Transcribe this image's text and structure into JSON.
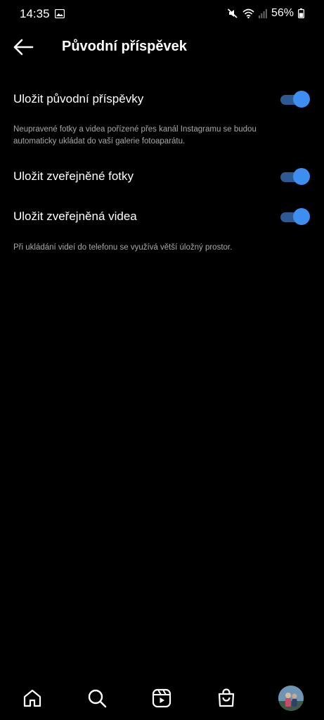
{
  "status_bar": {
    "time": "14:35",
    "battery": "56%",
    "icons": [
      "gallery-icon",
      "mute-icon",
      "wifi-icon",
      "signal-icon",
      "battery-icon"
    ]
  },
  "header": {
    "title": "Původní příspěvek",
    "back_icon": "back-arrow-icon"
  },
  "settings": [
    {
      "label": "Uložit původní příspěvky",
      "enabled": true,
      "description": "Neupravené fotky a videa pořízené přes kanál Instagramu se budou automaticky ukládat do vaší galerie fotoaparátu."
    },
    {
      "label": "Uložit zveřejněné fotky",
      "enabled": true
    },
    {
      "label": "Uložit zveřejněná videa",
      "enabled": true,
      "description": "Při ukládání videí do telefonu se využívá větší úložný prostor."
    }
  ],
  "colors": {
    "background": "#000000",
    "toggle_thumb": "#3d8ef0",
    "toggle_track": "#2e5a94",
    "description_text": "#a8a8a8"
  },
  "bottom_nav": {
    "items": [
      "home-icon",
      "search-icon",
      "reels-icon",
      "shop-icon",
      "profile-avatar"
    ]
  }
}
